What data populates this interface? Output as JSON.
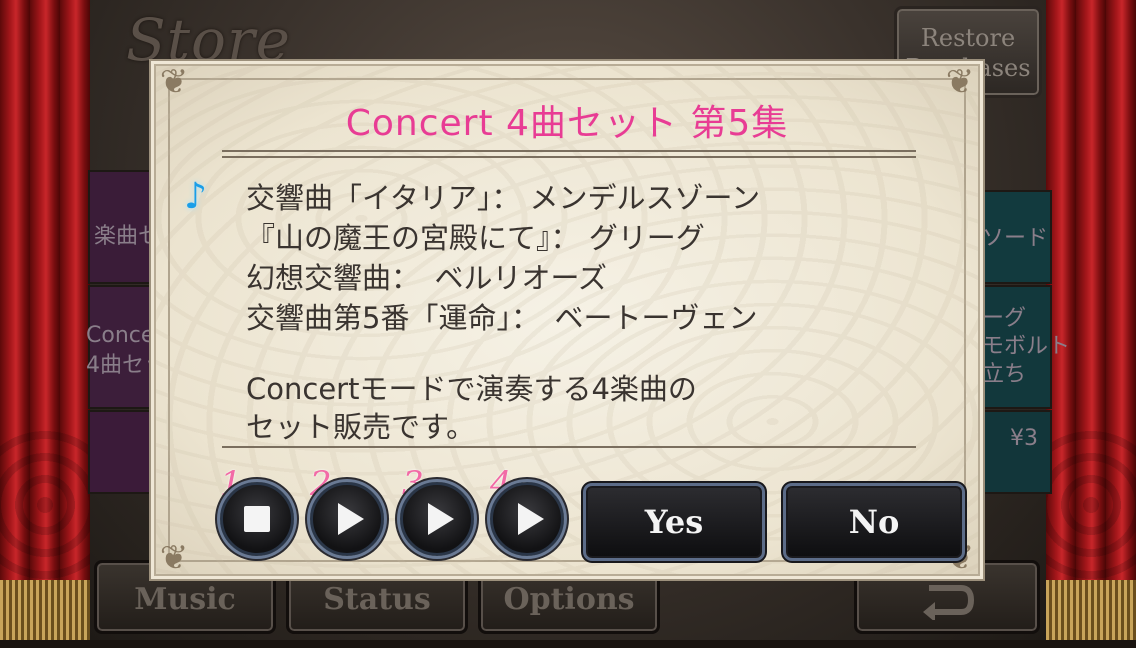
{
  "background": {
    "store_title": "Store",
    "restore_button": "Restore Purchases",
    "left_cards": [
      "楽曲セ",
      "Conce\n4曲セッ"
    ],
    "right_cards": [
      "ソード",
      "ーグ\nモボルト\n立ち",
      "¥3"
    ],
    "nav": {
      "music": "Music",
      "status": "Status",
      "options": "Options",
      "back_icon": "return-arrow-icon"
    }
  },
  "dialog": {
    "title": "Concert 4曲セット 第5集",
    "note_icon": "music-note-icon",
    "songs": [
      "交響曲「イタリア」： メンデルスゾーン",
      "『山の魔王の宮殿にて』： グリーグ",
      "幻想交響曲：　ベルリオーズ",
      "交響曲第5番「運命」：　ベートーヴェン"
    ],
    "description": [
      "Concertモードで演奏する4楽曲の",
      "セット販売です。"
    ],
    "previews": [
      {
        "number": "1",
        "state": "stop"
      },
      {
        "number": "2",
        "state": "play"
      },
      {
        "number": "3",
        "state": "play"
      },
      {
        "number": "4",
        "state": "play"
      }
    ],
    "yes_label": "Yes",
    "no_label": "No"
  },
  "colors": {
    "title_pink": "#e83c94",
    "number_pink": "#f26aa6",
    "note_blue": "#1a9ee8"
  }
}
